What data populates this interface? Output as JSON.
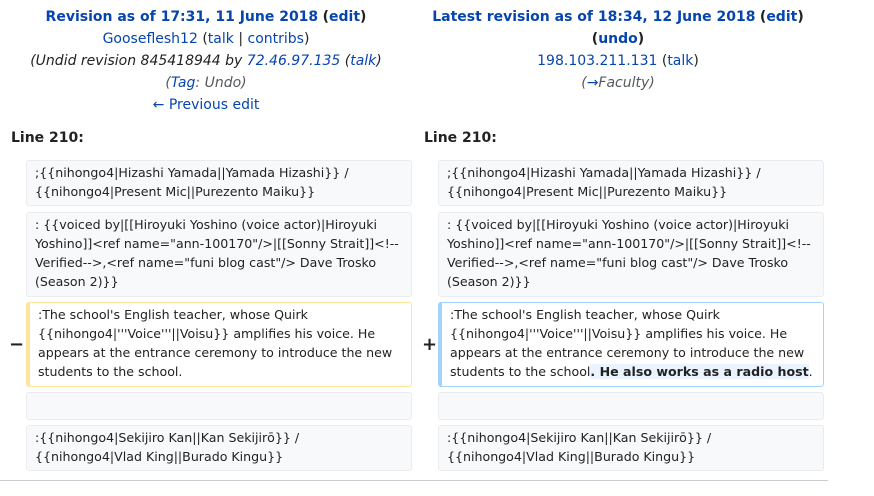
{
  "left_header": {
    "rev_title": "Revision as of 17:31, 11 June 2018",
    "edit": "edit",
    "user": "Gooseflesh12",
    "talk": "talk",
    "contribs": "contribs",
    "undid_prefix": "(Undid revision 845418944 by ",
    "undid_ip": "72.46.97.135",
    "undid_talk": "talk",
    "undid_suffix": ")",
    "tag_label": "Tag",
    "tag_value": ": Undo",
    "prev_edit": "← Previous edit"
  },
  "right_header": {
    "rev_title": "Latest revision as of 18:34, 12 June 2018",
    "edit": "edit",
    "undo": "undo",
    "user": "198.103.211.131",
    "talk": "talk",
    "section_arrow": "→",
    "section": "Faculty"
  },
  "line_label_left": "Line 210:",
  "line_label_right": "Line 210:",
  "rows": {
    "r1": ";{{nihongo4|Hizashi Yamada||Yamada Hizashi}} / {{nihongo4|Present Mic||Purezento Maiku}}",
    "r2": ": {{voiced by|[[Hiroyuki Yoshino (voice actor)|Hiroyuki Yoshino]]<ref name=\"ann-100170\"/>|[[Sonny Strait]]<!--Verified-->,<ref name=\"funi blog cast\"/> Dave Trosko (Season 2)}}",
    "r3_left": ":The school's English teacher, whose Quirk {{nihongo4|'''Voice'''||Voisu}} amplifies his voice. He appears at the entrance ceremony to introduce the new students to the school.",
    "r3_right_main": ":The school's English teacher, whose Quirk {{nihongo4|'''Voice'''||Voisu}} amplifies his voice. He appears at the entrance ceremony to introduce the new students to the school",
    "r3_right_ins": ". He also works as a radio host",
    "r3_right_end": ".",
    "r5": ":{{nihongo4|Sekijiro Kan||Kan Sekijirō}} / {{nihongo4|Vlad King||Burado Kingu}}"
  },
  "markers": {
    "minus": "−",
    "plus": "+"
  }
}
